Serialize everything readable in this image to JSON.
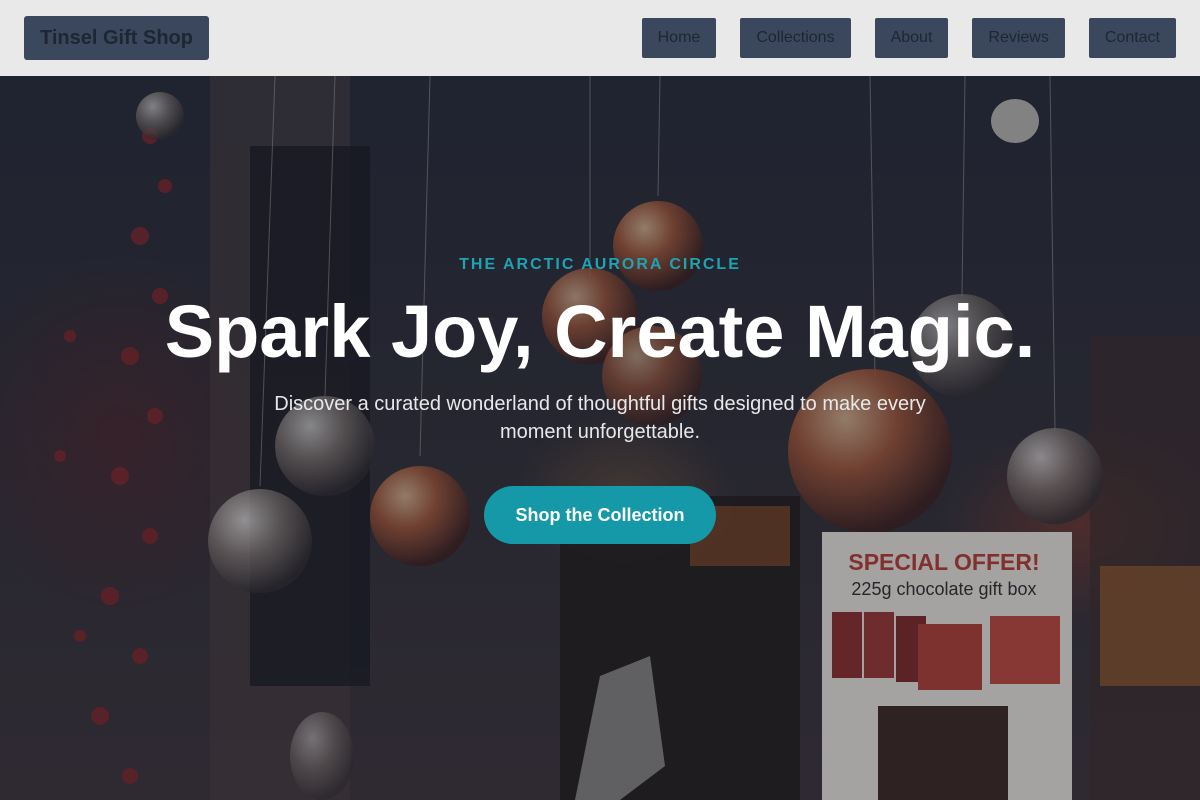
{
  "nav": {
    "brand": "Tinsel Gift Shop",
    "links": [
      "Home",
      "Collections",
      "About",
      "Reviews",
      "Contact"
    ]
  },
  "hero": {
    "eyebrow": "THE ARCTIC AURORA CIRCLE",
    "headline": "Spark Joy, Create Magic.",
    "subtext": "Discover a curated wonderland of thoughtful gifts designed to make every moment unforgettable.",
    "cta_label": "Shop the Collection",
    "sign": {
      "title": "SPECIAL OFFER!",
      "subtitle": "225g chocolate gift box"
    }
  },
  "colors": {
    "nav_bg": "#e9e9ea",
    "nav_button": "#3b475d",
    "accent": "#1599a8",
    "eyebrow": "#1ea3b3"
  }
}
